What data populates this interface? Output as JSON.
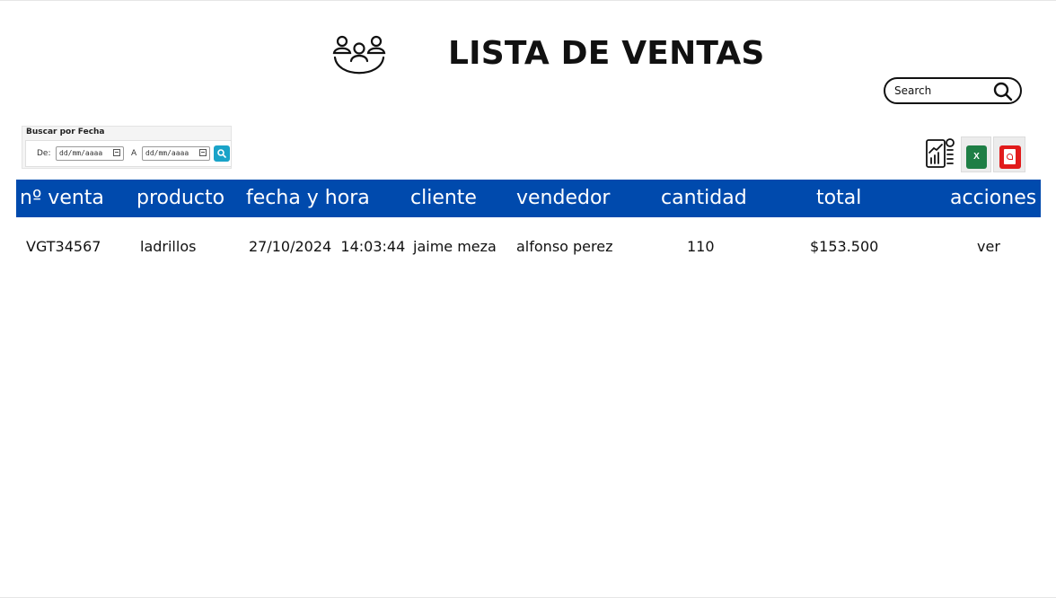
{
  "header": {
    "title": "LISTA DE VENTAS",
    "icon": "people-group-icon"
  },
  "search": {
    "placeholder": "Search",
    "icon": "search-icon"
  },
  "date_filter": {
    "title": "Buscar por Fecha",
    "from_label": "De:",
    "to_label": "A",
    "from_placeholder": "dd/mm/aaaa",
    "to_placeholder": "dd/mm/aaaa",
    "button_icon": "search-icon",
    "button_color": "#1aa3c8"
  },
  "actions": {
    "report_icon": "report-chart-icon",
    "excel_label": "X",
    "excel_color": "#1e7e45",
    "pdf_icon": "pdf-icon",
    "pdf_color": "#e11b1b"
  },
  "table": {
    "header_color": "#004aad",
    "columns": [
      "nº venta",
      "producto",
      "fecha y hora",
      "cliente",
      "vendedor",
      "cantidad",
      "total",
      "acciones"
    ],
    "rows": [
      {
        "venta": "VGT34567",
        "producto": "ladrillos",
        "fecha_hora": "27/10/2024  14:03:44",
        "cliente": "jaime meza",
        "vendedor": "alfonso perez",
        "cantidad": "110",
        "total": "$153.500",
        "accion": "ver"
      }
    ]
  }
}
